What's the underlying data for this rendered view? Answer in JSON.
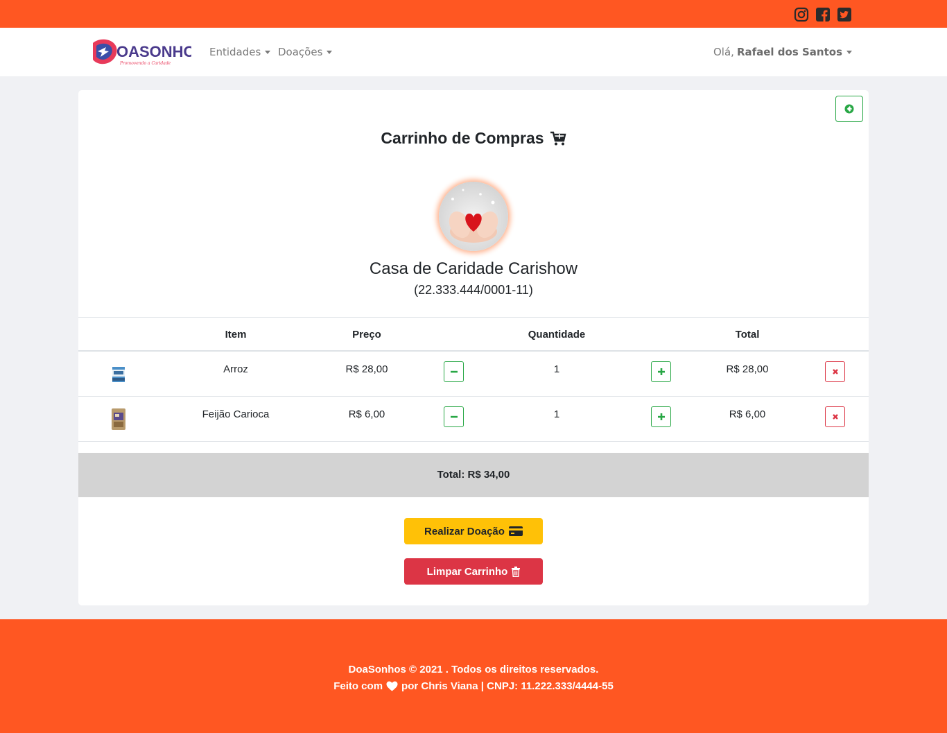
{
  "topbar": {
    "social_icons": [
      "instagram-icon",
      "facebook-icon",
      "twitter-icon"
    ],
    "color": "#ff5722"
  },
  "navbar": {
    "logo_text": "DOASONHOS",
    "logo_tagline": "Promovendo a Caridade",
    "menu": [
      {
        "label": "Entidades"
      },
      {
        "label": "Doações"
      }
    ],
    "greeting": "Olá,",
    "user_name": "Rafael dos Santos"
  },
  "cart": {
    "title": "Carrinho de Compras",
    "entity_name": "Casa de Caridade Carishow",
    "entity_document": "(22.333.444/0001-11)",
    "columns": {
      "item": "Item",
      "price": "Preço",
      "quantity": "Quantidade",
      "total": "Total"
    },
    "rows": [
      {
        "item": "Arroz",
        "price": "R$ 28,00",
        "quantity": "1",
        "total": "R$ 28,00"
      },
      {
        "item": "Feijão Carioca",
        "price": "R$ 6,00",
        "quantity": "1",
        "total": "R$ 6,00"
      }
    ],
    "grand_total": "Total: R$ 34,00",
    "donate_label": "Realizar Doação",
    "clear_label": "Limpar Carrinho"
  },
  "footer": {
    "line1": "DoaSonhos © 2021 . Todos os direitos reservados.",
    "line2_prefix": "Feito com",
    "line2_suffix": "por Chris Viana | CNPJ: 11.222.333/4444-55"
  },
  "colors": {
    "accent": "#ff5722",
    "success": "#28a745",
    "danger": "#dc3545",
    "warning": "#ffc107"
  }
}
